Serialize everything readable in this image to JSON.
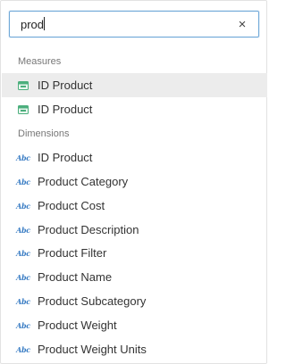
{
  "search": {
    "value": "prod",
    "clear_symbol": "×"
  },
  "measures": {
    "header": "Measures",
    "items": [
      {
        "label": "ID Product",
        "selected": true
      },
      {
        "label": "ID Product",
        "selected": false
      }
    ]
  },
  "dimensions": {
    "header": "Dimensions",
    "icon_text": "Abc",
    "items": [
      {
        "label": "ID Product"
      },
      {
        "label": "Product Category"
      },
      {
        "label": "Product Cost"
      },
      {
        "label": "Product Description"
      },
      {
        "label": "Product Filter"
      },
      {
        "label": "Product Name"
      },
      {
        "label": "Product Subcategory"
      },
      {
        "label": "Product Weight"
      },
      {
        "label": "Product Weight Units"
      }
    ]
  },
  "colors": {
    "measure_icon": "#4caf7d",
    "dimension_icon": "#3a7dc4",
    "selected_row": "#ececec",
    "search_border": "#6fa8d8"
  },
  "icons": {
    "measure": "measure-icon",
    "dimension": "abc-text-icon",
    "clear": "close-icon"
  }
}
